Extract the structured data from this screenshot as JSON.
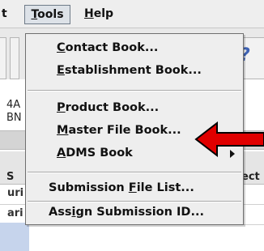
{
  "menubar": {
    "partial_menu": "t",
    "tools": {
      "mnemonic": "T",
      "rest": "ools"
    },
    "help": {
      "mnemonic": "H",
      "rest": "elp"
    }
  },
  "background": {
    "cell_lines": [
      "4A",
      "BN"
    ],
    "table_header_fragments": {
      "left": "S",
      "right": "ect"
    },
    "row_fragments": [
      "uri",
      "ari"
    ],
    "toolbar_icon": "?"
  },
  "dropdown": {
    "items": [
      {
        "mnemonic": "C",
        "pre": "",
        "post": "ontact Book..."
      },
      {
        "mnemonic": "E",
        "pre": "",
        "post": "stablishment Book..."
      },
      {
        "mnemonic": "P",
        "pre": "",
        "post": "roduct Book..."
      },
      {
        "mnemonic": "M",
        "pre": "",
        "post": "aster File Book..."
      },
      {
        "mnemonic": "A",
        "pre": "",
        "post": "DMS Book"
      },
      {
        "mnemonic": "F",
        "pre": "Submission ",
        "post": "ile List..."
      },
      {
        "mnemonic": "i",
        "pre": "Ass",
        "post": "gn Submission ID..."
      }
    ]
  },
  "annotation": {
    "arrow_color": "#e00000",
    "arrow_outline": "#000000"
  }
}
